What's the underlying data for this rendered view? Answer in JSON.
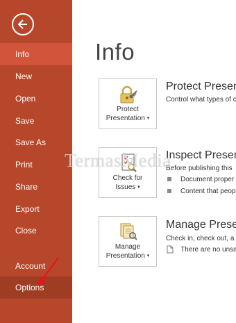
{
  "nav": {
    "items": [
      {
        "label": "Info",
        "active": true
      },
      {
        "label": "New"
      },
      {
        "label": "Open"
      },
      {
        "label": "Save"
      },
      {
        "label": "Save As"
      },
      {
        "label": "Print"
      },
      {
        "label": "Share"
      },
      {
        "label": "Export"
      },
      {
        "label": "Close"
      },
      {
        "label": "Account"
      },
      {
        "label": "Options"
      }
    ]
  },
  "main": {
    "title": "Info",
    "sections": [
      {
        "tile_label_1": "Protect",
        "tile_label_2": "Presentation",
        "title": "Protect Presentation",
        "description": "Control what types of c"
      },
      {
        "tile_label_1": "Check for",
        "tile_label_2": "Issues",
        "title": "Inspect Presentation",
        "description": "Before publishing this",
        "bullets": [
          "Document proper",
          "Content that peop"
        ]
      },
      {
        "tile_label_1": "Manage",
        "tile_label_2": "Presentation",
        "title": "Manage Presentation",
        "description": "Check in, check out, a",
        "note": "There are no unsa"
      }
    ]
  },
  "watermark": "TermasMedia",
  "colors": {
    "sidebar": "#b7472a",
    "active_item": "#d2543a",
    "options_highlight": "#9f3d24",
    "annotation_arrow": "#e8121d"
  },
  "icons": [
    "back-arrow-icon",
    "lock-key-icon",
    "inspect-checklist-icon",
    "manage-documents-icon",
    "document-icon",
    "annotation-arrow"
  ]
}
